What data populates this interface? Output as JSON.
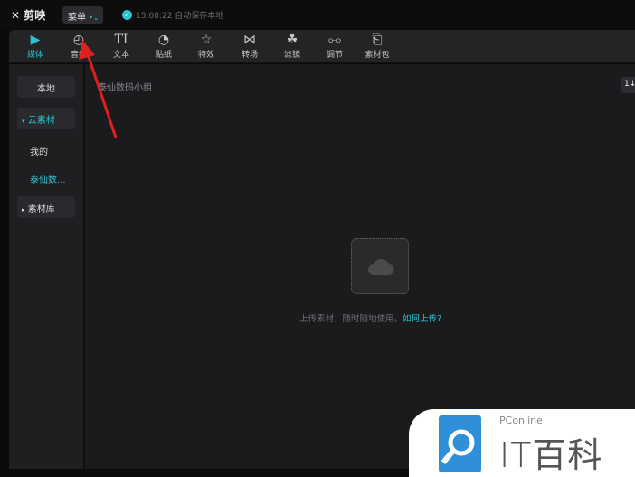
{
  "app": {
    "name": "剪映",
    "menu_label": "菜单",
    "save_status": "15:08:22 自动保存本地"
  },
  "toolbar": {
    "tabs": [
      {
        "label": "媒体",
        "icon": "media-icon",
        "active": true
      },
      {
        "label": "音频",
        "icon": "audio-icon"
      },
      {
        "label": "文本",
        "icon": "text-icon"
      },
      {
        "label": "贴纸",
        "icon": "sticker-icon"
      },
      {
        "label": "特效",
        "icon": "effects-icon"
      },
      {
        "label": "转场",
        "icon": "transition-icon"
      },
      {
        "label": "滤镜",
        "icon": "filter-icon"
      },
      {
        "label": "调节",
        "icon": "adjust-icon"
      },
      {
        "label": "素材包",
        "icon": "package-icon"
      }
    ]
  },
  "sidebar": {
    "local": "本地",
    "cloud": "云素材",
    "mine": "我的",
    "team": "泰仙数...",
    "library": "素材库"
  },
  "main": {
    "breadcrumb": "泰仙数码小组",
    "sort_label": "1↓",
    "upload_hint": "上传素材，随时随地使用。",
    "upload_link": "如何上传?"
  },
  "watermark": {
    "brand": "PConline",
    "name": "IT百科"
  },
  "colors": {
    "accent": "#2bc3d0",
    "annotation_arrow": "#e02020"
  }
}
